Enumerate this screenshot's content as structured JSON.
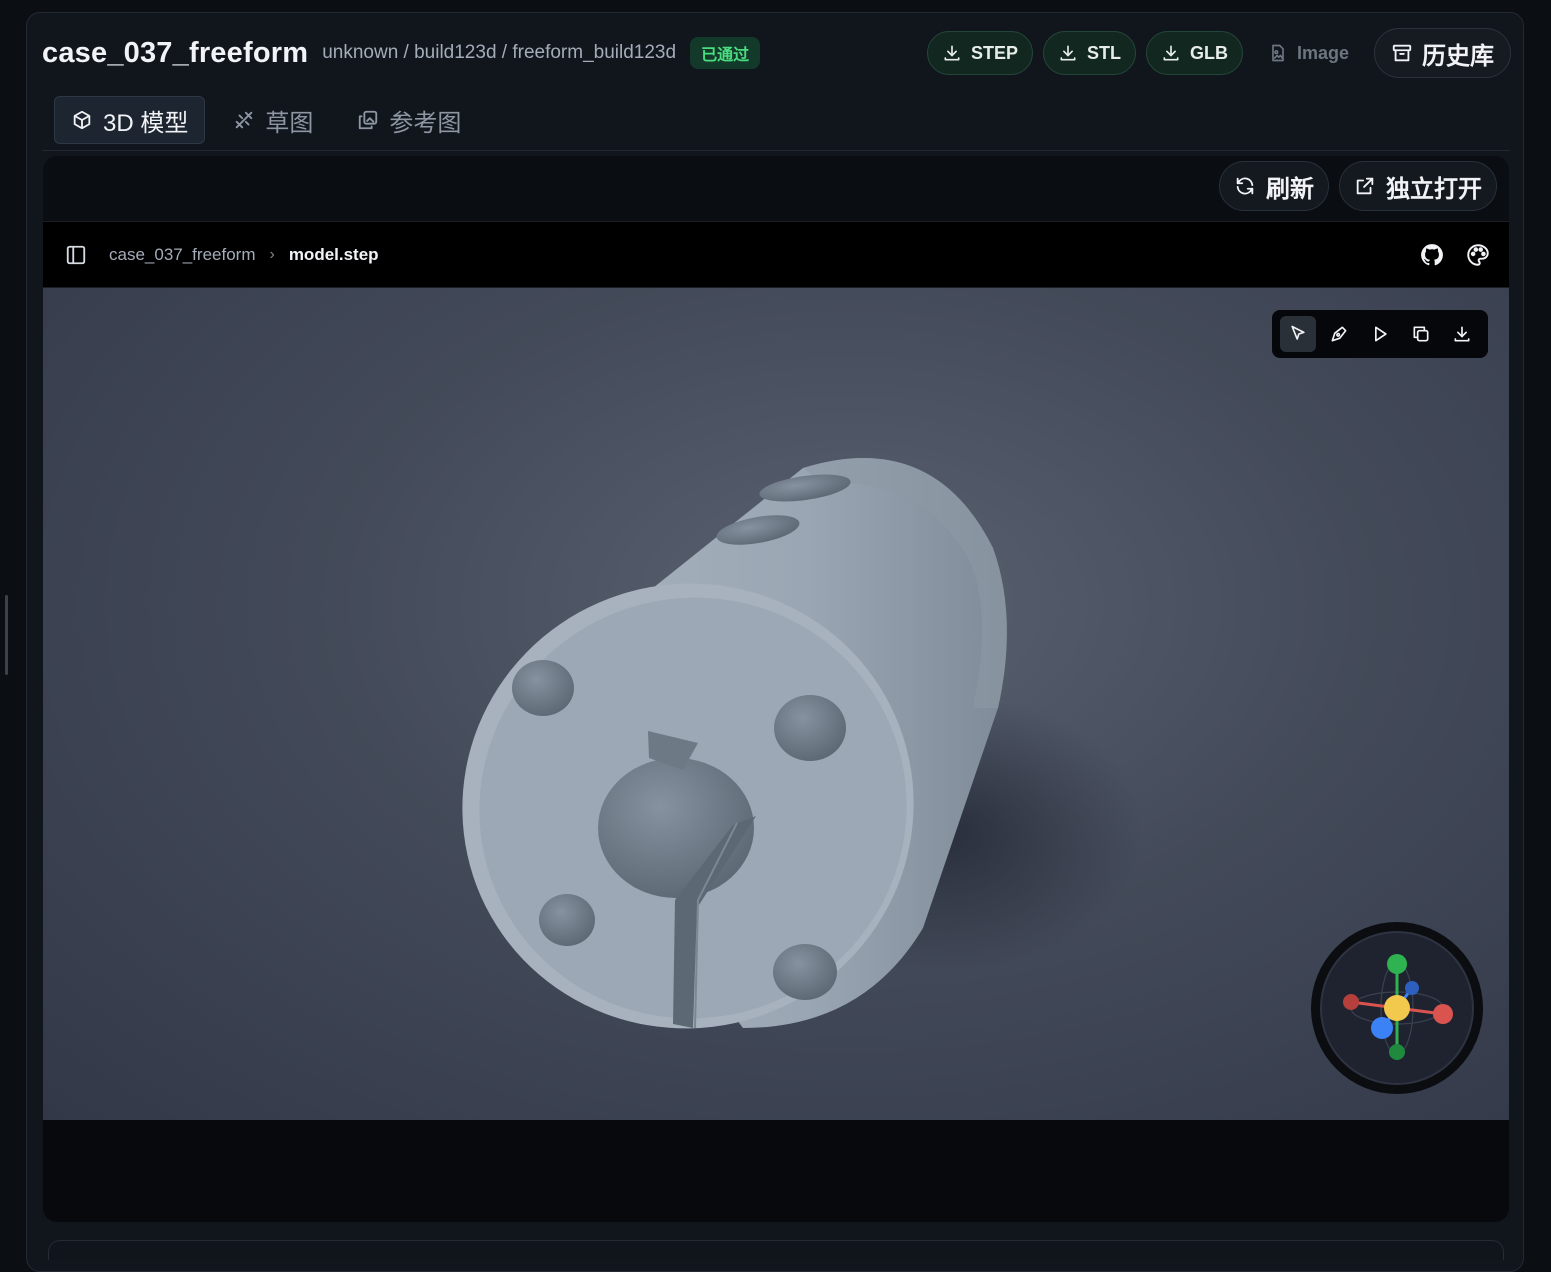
{
  "header": {
    "title": "case_037_freeform",
    "path": "unknown / build123d / freeform_build123d",
    "status_badge": "已通过",
    "downloads": [
      {
        "label": "STEP",
        "icon": "download-icon",
        "enabled": true
      },
      {
        "label": "STL",
        "icon": "download-icon",
        "enabled": true
      },
      {
        "label": "GLB",
        "icon": "download-icon",
        "enabled": true
      },
      {
        "label": "Image",
        "icon": "image-file-icon",
        "enabled": false
      }
    ],
    "history_label": "历史库"
  },
  "tabs": [
    {
      "label": "3D 模型",
      "icon": "cube-icon",
      "active": true
    },
    {
      "label": "草图",
      "icon": "sketch-icon",
      "active": false
    },
    {
      "label": "参考图",
      "icon": "images-icon",
      "active": false
    }
  ],
  "panel": {
    "refresh_label": "刷新",
    "open_standalone_label": "独立打开"
  },
  "viewer": {
    "breadcrumb": [
      "case_037_freeform",
      "model.step"
    ],
    "header_icons": [
      "github-icon",
      "palette-icon"
    ],
    "tools": [
      {
        "name": "select-icon",
        "active": true
      },
      {
        "name": "measure-pen-icon",
        "active": false
      },
      {
        "name": "play-icon",
        "active": false
      },
      {
        "name": "copy-icon",
        "active": false
      },
      {
        "name": "download-icon",
        "active": false
      }
    ]
  },
  "colors": {
    "accent_green": "#4ade80",
    "badge_bg": "#13392a",
    "model_gray": "#9aa6b3",
    "gizmo_x": "#d9534f",
    "gizmo_y": "#2fb350",
    "gizmo_z": "#3b82f6",
    "gizmo_center": "#f2c94c"
  }
}
